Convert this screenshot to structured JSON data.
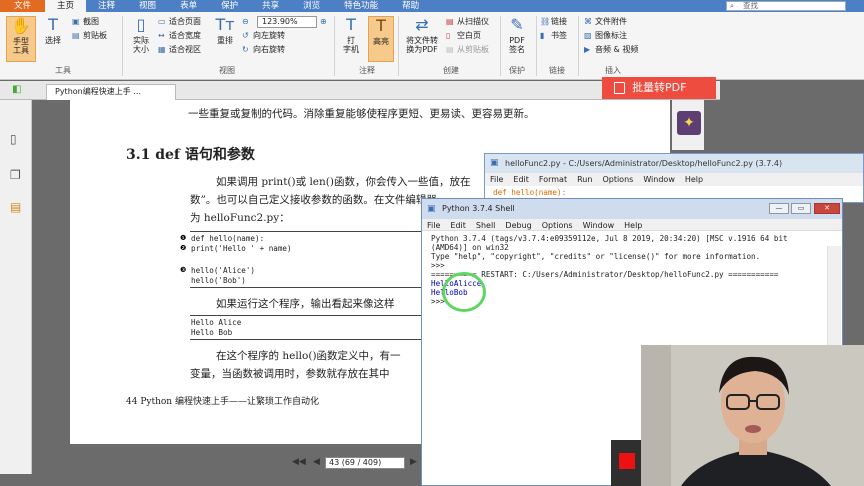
{
  "menubar": {
    "items": [
      "文件",
      "主页",
      "注释",
      "视图",
      "表单",
      "保护",
      "共享",
      "浏览",
      "特色功能",
      "帮助"
    ],
    "search_placeholder": "查找"
  },
  "ribbon": {
    "hand_tool": "手型\n工具",
    "select": "选择",
    "screenshot": "截图",
    "clipboard": "剪贴板",
    "actual_size": "实际\n大小",
    "fit_page": "适合页面",
    "fit_width": "适合宽度",
    "fit_view": "适合视区",
    "reflow": "重排",
    "zoom_value": "123.90%",
    "rotate_left": "向左旋转",
    "rotate_right": "向右旋转",
    "typewriter": "打\n字机",
    "highlight": "高亮",
    "convert": "将文件转\n换为PDF",
    "from_scanner": "从扫描仪",
    "blank_page": "空白页",
    "from_clipboard": "从剪贴板",
    "pdf_sign": "PDF\n签名",
    "link": "链接",
    "bookmark": "书签",
    "file_attach": "文件附件",
    "image_mark": "图像标注",
    "audio_video": "音频 & 视频",
    "groups": {
      "tools": "工具",
      "view": "视图",
      "annotate": "注释",
      "create": "创建",
      "protect": "保护",
      "link": "链接",
      "insert": "插入"
    }
  },
  "tab": {
    "doc_title": "Python编程快速上手 ..."
  },
  "batch_button": "批量转PDF",
  "page": {
    "top_line": "一些重复或复制的代码。消除重复能够使程序更短、更易读、更容易更新。",
    "heading": "3.1   def 语句和参数",
    "p1_l1": "如果调用 print()或 len()函数，你会传入一些值，放在",
    "p1_l2": "数”。也可以自己定义接收参数的函数。在文件编辑器",
    "p1_l3": "为 helloFunc2.py：",
    "code1": "def hello(name):",
    "code2": "    print('Hello ' + name)",
    "code3": "hello('Alice')",
    "code4": "hello('Bob')",
    "markers": [
      "❶",
      "❷",
      "❸"
    ],
    "p2": "如果运行这个程序，输出看起来像这样",
    "out1": "Hello Alice",
    "out2": "Hello Bob",
    "p3_l1": "在这个程序的 hello()函数定义中，有一",
    "p3_l2": "变量，当函数被调用时，参数就存放在其中",
    "footer": "44   Python 编程快速上手——让繁琐工作自动化"
  },
  "pager": {
    "value": "43 (69 / 409)"
  },
  "editor": {
    "title": "helloFunc2.py - C:/Users/Administrator/Desktop/helloFunc2.py (3.7.4)",
    "menu": [
      "File",
      "Edit",
      "Format",
      "Run",
      "Options",
      "Window",
      "Help"
    ],
    "line": "def hello(name):"
  },
  "shell": {
    "title": "Python 3.7.4 Shell",
    "menu": [
      "File",
      "Edit",
      "Shell",
      "Debug",
      "Options",
      "Window",
      "Help"
    ],
    "l1": "Python 3.7.4 (tags/v3.7.4:e09359112e, Jul  8 2019, 20:34:20) [MSC v.1916 64 bit",
    "l2": "(AMD64)] on win32",
    "l3": "Type \"help\", \"copyright\", \"credits\" or \"license()\" for more information.",
    "l4": ">>> ",
    "l5": "========== RESTART: C:/Users/Administrator/Desktop/helloFunc2.py ===========",
    "l6": "HelloAlicce",
    "l7": "HelloBob",
    "l8": ">>> "
  },
  "colors": {
    "menubar": "#4d7fc4",
    "file_tab": "#e26b22",
    "batch": "#ee4c3e",
    "highlight": "#f7c98a"
  }
}
